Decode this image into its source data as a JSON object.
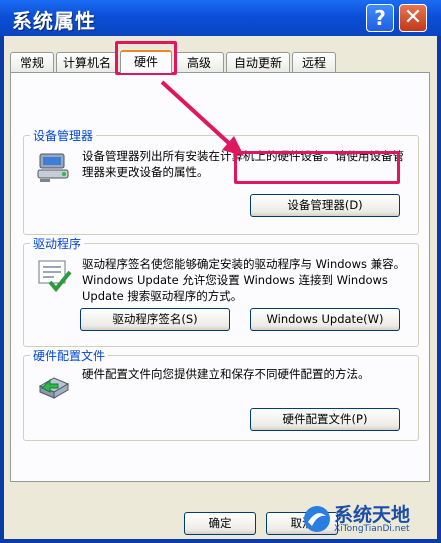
{
  "window": {
    "title": "系统属性",
    "help_label": "?",
    "close_label": "✕"
  },
  "tabs": [
    {
      "label": "常规"
    },
    {
      "label": "计算机名"
    },
    {
      "label": "硬件"
    },
    {
      "label": "高级"
    },
    {
      "label": "自动更新"
    },
    {
      "label": "远程"
    }
  ],
  "active_tab": "硬件",
  "device_manager": {
    "title": "设备管理器",
    "icon": "device-manager-icon",
    "description": "设备管理器列出所有安装在计算机上的硬件设备。请使用设备管理器来更改设备的属性。",
    "button": "设备管理器(D)"
  },
  "drivers": {
    "title": "驱动程序",
    "icon": "driver-signing-icon",
    "description": "驱动程序签名使您能够确定安装的驱动程序与 Windows 兼容。Windows Update 允许您设置 Windows 连接到 Windows Update 搜索驱动程序的方式。",
    "sign_button": "驱动程序签名(S)",
    "update_button": "Windows Update(W)"
  },
  "hardware_profiles": {
    "title": "硬件配置文件",
    "icon": "hardware-profile-icon",
    "description": "硬件配置文件向您提供建立和保存不同硬件配置的方法。",
    "button": "硬件配置文件(P)"
  },
  "footer": {
    "ok_button": "确定",
    "cancel_button": "取消"
  },
  "highlight_color": "#e0175f",
  "watermark": {
    "text": "系统天地",
    "url": "XiTongTianDi.net"
  }
}
